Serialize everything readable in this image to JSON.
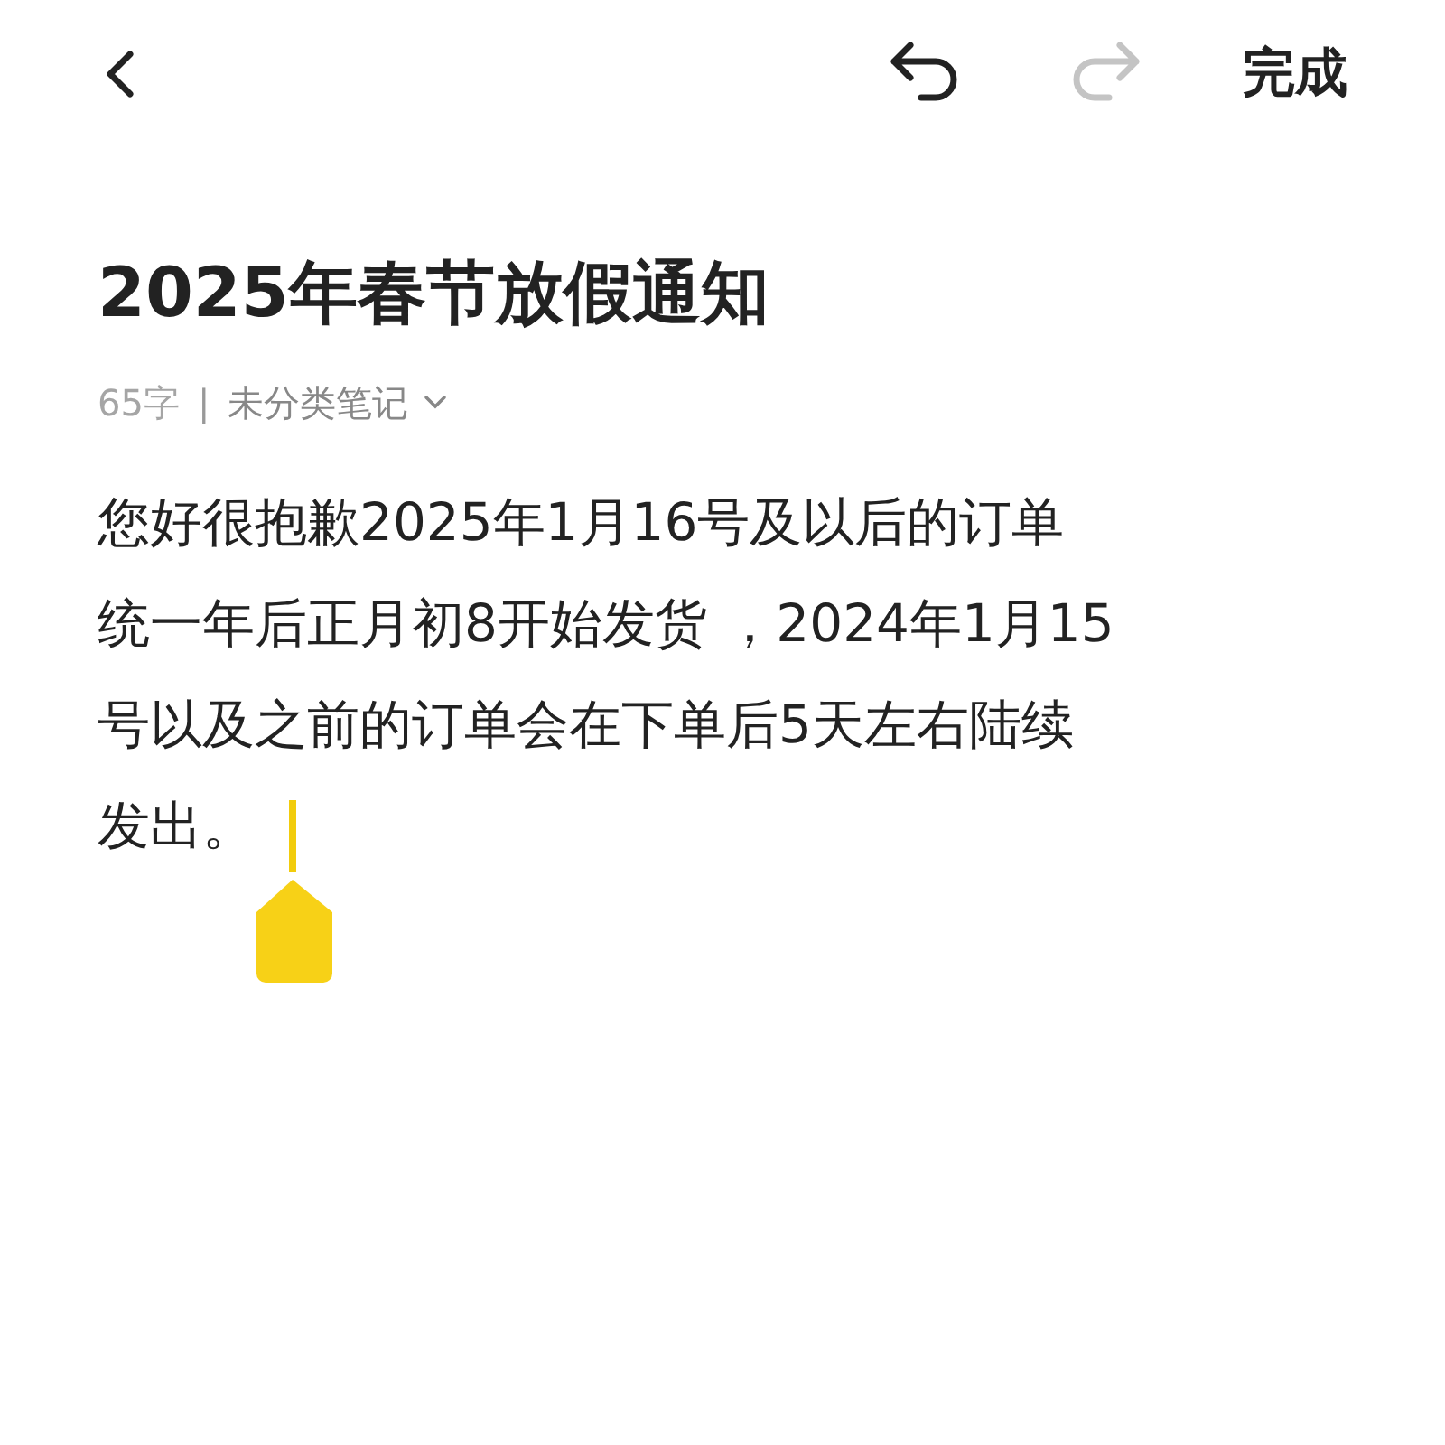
{
  "toolbar": {
    "undo": {
      "disabled": false
    },
    "redo": {
      "disabled": true
    },
    "done_label": "完成"
  },
  "title": "2025年春节放假通知",
  "meta": {
    "word_count": "65字",
    "separator": "|",
    "category": "未分类笔记"
  },
  "body_lines": [
    "您好很抱歉2025年1月16号及以后的订单",
    "统一年后正月初8开始发货 ，2024年1月15",
    "号以及之前的订单会在下单后5天左右陆续",
    "发出。"
  ]
}
